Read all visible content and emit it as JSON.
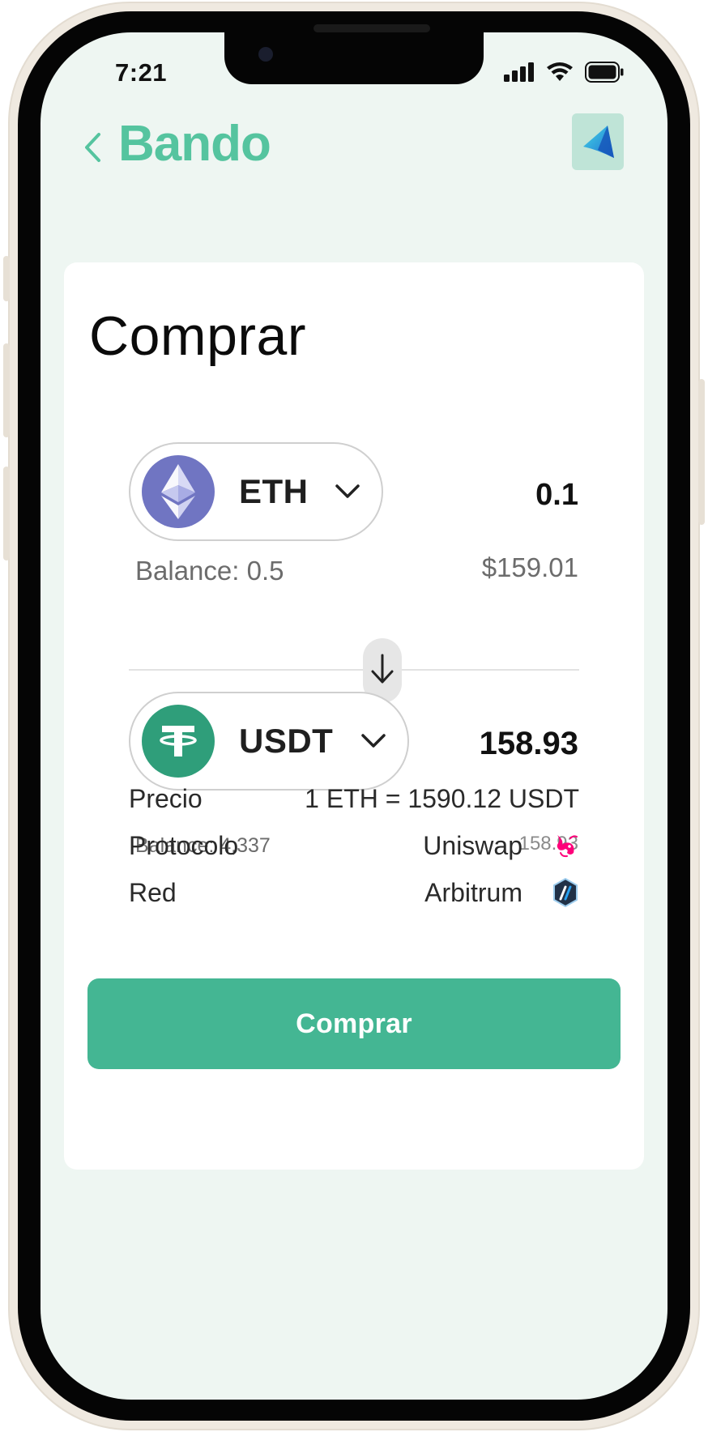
{
  "status_bar": {
    "time": "7:21",
    "icons": [
      "cellular-signal-icon",
      "wifi-icon",
      "battery-icon"
    ]
  },
  "header": {
    "brand": "Bando",
    "back_icon": "chevron-left-icon",
    "logo_icon": "bando-logo-icon"
  },
  "swap": {
    "title": "Comprar",
    "from": {
      "symbol": "ETH",
      "icon": "ethereum-icon",
      "amount": "0.1",
      "balance": "Balance: 0.5",
      "fiat_value": "$159.01"
    },
    "to": {
      "symbol": "USDT",
      "icon": "tether-icon",
      "amount": "158.93",
      "balance": "Balance: 4,337",
      "fiat_value": "158.93"
    },
    "swap_icon": "arrow-down-icon"
  },
  "details": {
    "price_label": "Precio",
    "price_value": "1 ETH = 1590.12 USDT",
    "protocol_label": "Protocolo",
    "protocol_value": "Uniswap",
    "protocol_icon": "uniswap-icon",
    "network_label": "Red",
    "network_value": "Arbitrum",
    "network_icon": "arbitrum-icon"
  },
  "actions": {
    "buy_label": "Comprar"
  },
  "colors": {
    "brand": "#55c49f",
    "primary_button": "#44b693",
    "screen_background": "#eef6f2",
    "eth": "#7075c2",
    "usdt": "#2f9e7a"
  }
}
